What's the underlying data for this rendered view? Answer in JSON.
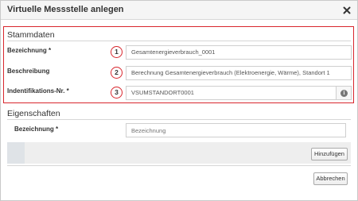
{
  "dialog": {
    "title": "Virtuelle Messstelle anlegen",
    "close_icon": "close-icon"
  },
  "stammdaten": {
    "title": "Stammdaten",
    "fields": [
      {
        "number": "1",
        "label": "Bezeichnung *",
        "value": "Gesamtenergieverbrauch_0001"
      },
      {
        "number": "2",
        "label": "Beschreibung",
        "value": "Berechnung Gesamtenergieverbrauch (Elektroenergie, Wärme), Standort 1"
      },
      {
        "number": "3",
        "label": "Indentifikations-Nr. *",
        "value": "VSUMSTANDORT0001",
        "info_icon": "info-icon"
      }
    ]
  },
  "eigenschaften": {
    "title": "Eigenschaften",
    "label": "Bezeichnung *",
    "placeholder": "Bezeichnung",
    "add_button": "Hinzufügen"
  },
  "footer": {
    "cancel_button": "Abbrechen"
  },
  "colors": {
    "highlight": "#d8262d",
    "titlebar": "#f5f5f5",
    "grey_bar": "#eeeeee"
  }
}
